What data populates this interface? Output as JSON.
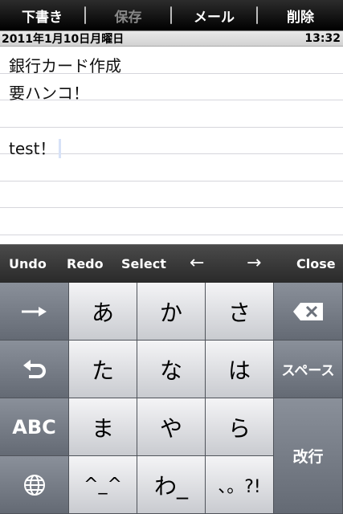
{
  "toolbar": {
    "draft_label": "下書き",
    "save_label": "保存",
    "mail_label": "メール",
    "delete_label": "削除"
  },
  "datebar": {
    "date": "2011年1月10日月曜日",
    "time": "13:32"
  },
  "note": {
    "lines": [
      "銀行カード作成",
      "要ハンコ！",
      "",
      "test！",
      "",
      "",
      ""
    ]
  },
  "editbar": {
    "undo": "Undo",
    "redo": "Redo",
    "select": "Select",
    "left_arrow": "←",
    "right_arrow": "→",
    "close": "Close"
  },
  "keyboard": {
    "row1": [
      "あ",
      "か",
      "さ"
    ],
    "row2": [
      "た",
      "な",
      "は"
    ],
    "row3": [
      "ま",
      "や",
      "ら"
    ],
    "row4": [
      "^_^",
      "わ_",
      "、。?!"
    ],
    "space": "スペース",
    "abc": "ABC",
    "enter": "改行"
  },
  "icons": {
    "next": "arrow-right-icon",
    "undo": "undo-icon",
    "globe": "globe-icon",
    "backspace": "backspace-icon"
  }
}
